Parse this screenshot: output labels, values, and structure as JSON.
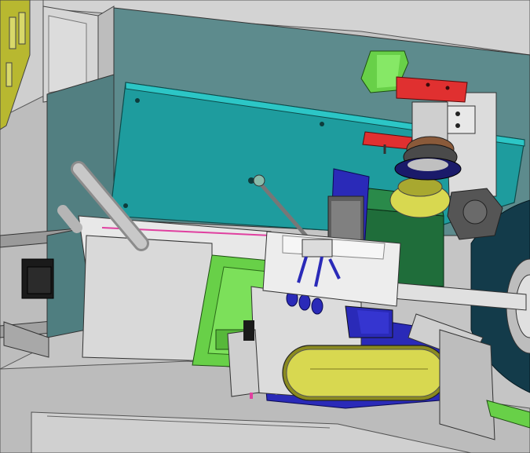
{
  "scene": {
    "kind": "cad-assembly-render",
    "colors": {
      "background": "#c9c9c9",
      "frame": "#cfcfcf",
      "inner_wall": "#5d8b8d",
      "teal_plate": "#1e9c9e",
      "yellow": "#d8d850",
      "blue": "#2a2ab8",
      "green": "#68d048",
      "dark_green": "#1f6d3a",
      "red": "#e03030",
      "navy_disk": "#133b4a",
      "pink_line": "#e040a0",
      "motor_black": "#1a1a1a"
    }
  }
}
